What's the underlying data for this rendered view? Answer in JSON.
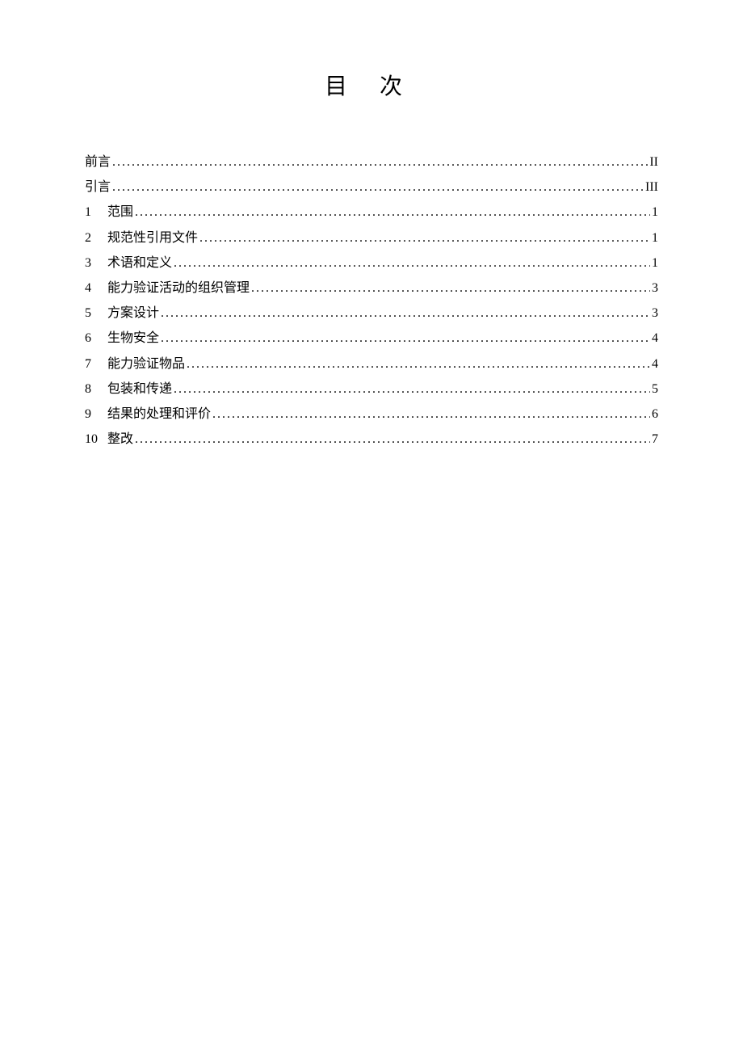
{
  "title": "目次",
  "toc": {
    "entries": [
      {
        "num": "",
        "label": "前言",
        "page": "II"
      },
      {
        "num": "",
        "label": "引言",
        "page": "III"
      },
      {
        "num": "1",
        "label": "范围",
        "page": "1"
      },
      {
        "num": "2",
        "label": "规范性引用文件",
        "page": "1"
      },
      {
        "num": "3",
        "label": "术语和定义",
        "page": "1"
      },
      {
        "num": "4",
        "label": "能力验证活动的组织管理",
        "page": "3"
      },
      {
        "num": "5",
        "label": "方案设计",
        "page": "3"
      },
      {
        "num": "6",
        "label": "生物安全",
        "page": "4"
      },
      {
        "num": "7",
        "label": "能力验证物品",
        "page": "4"
      },
      {
        "num": "8",
        "label": "包装和传递",
        "page": "5"
      },
      {
        "num": "9",
        "label": "结果的处理和评价",
        "page": "6"
      },
      {
        "num": "10",
        "label": "整改",
        "page": "7"
      }
    ]
  }
}
